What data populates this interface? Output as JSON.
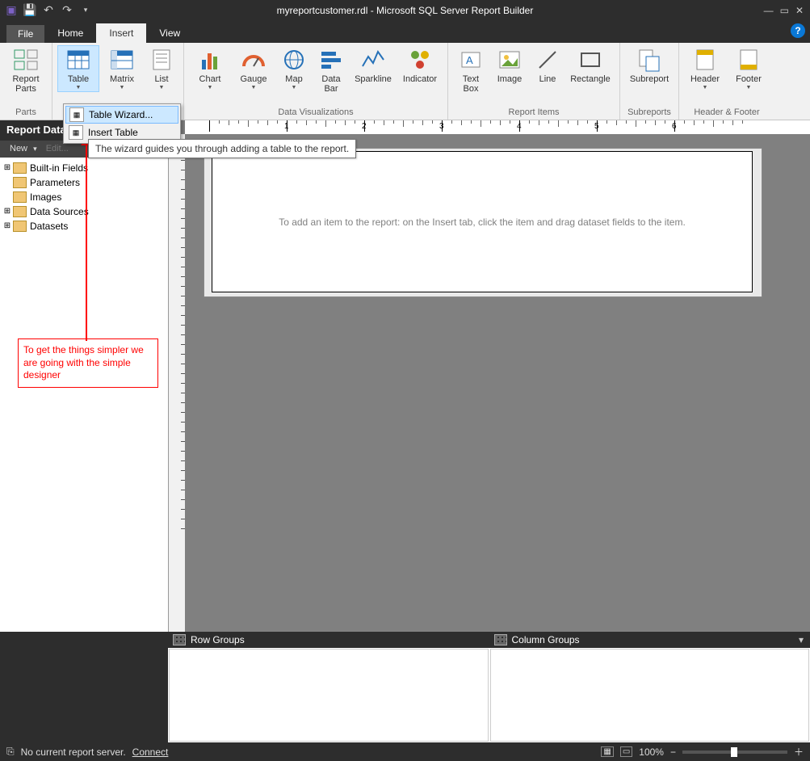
{
  "window": {
    "title": "myreportcustomer.rdl - Microsoft SQL Server Report Builder"
  },
  "qat": {
    "undo": "↶",
    "redo": "↷"
  },
  "tabs": {
    "file": "File",
    "home": "Home",
    "insert": "Insert",
    "view": "View",
    "active": "Insert"
  },
  "ribbon": {
    "parts": {
      "report_parts": "Report\nParts",
      "group": "Parts"
    },
    "data_regions": {
      "table": "Table",
      "matrix": "Matrix",
      "list": "List",
      "group": ""
    },
    "dataviz": {
      "chart": "Chart",
      "gauge": "Gauge",
      "map": "Map",
      "databar": "Data\nBar",
      "sparkline": "Sparkline",
      "indicator": "Indicator",
      "group": "Data Visualizations"
    },
    "reportitems": {
      "textbox": "Text\nBox",
      "image": "Image",
      "line": "Line",
      "rectangle": "Rectangle",
      "group": "Report Items"
    },
    "subreports": {
      "subreport": "Subreport",
      "group": "Subreports"
    },
    "headerfooter": {
      "header": "Header",
      "footer": "Footer",
      "group": "Header & Footer"
    }
  },
  "dropdown": {
    "wizard": "Table Wizard...",
    "insert_table": "Insert Table",
    "tooltip": "The wizard guides you through adding a table to the report."
  },
  "reportdata": {
    "title": "Report Data",
    "new": "New",
    "edit": "Edit...",
    "items": [
      "Built-in Fields",
      "Parameters",
      "Images",
      "Data Sources",
      "Datasets"
    ]
  },
  "annotation": "To get the things simpler we are going with the simple designer",
  "canvas": {
    "placeholder": "To add an item to the report: on the Insert tab, click the item and drag dataset fields to the item."
  },
  "ruler": {
    "marks": [
      1,
      2,
      3,
      4,
      5,
      6
    ]
  },
  "groups": {
    "row": "Row Groups",
    "col": "Column Groups"
  },
  "status": {
    "icon": "⎘",
    "message": "No current report server.",
    "connect": "Connect",
    "zoom": "100%",
    "minus": "−",
    "plus": "＋"
  }
}
